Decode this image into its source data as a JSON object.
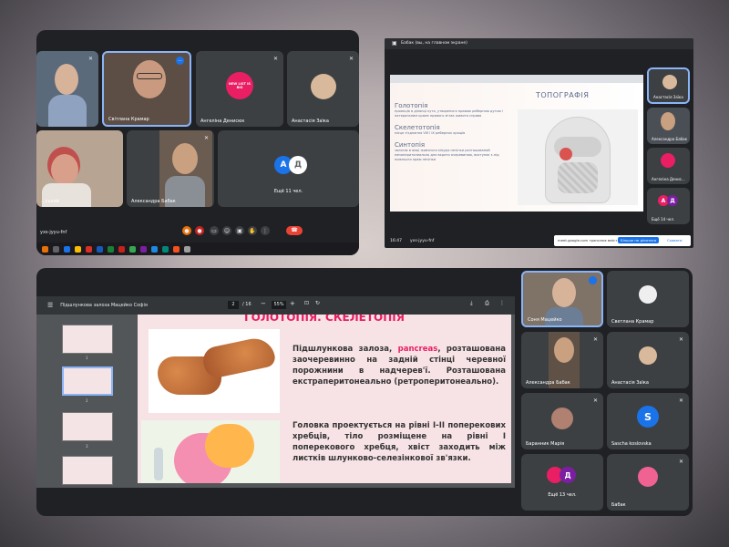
{
  "meet_top_left": {
    "participants": [
      {
        "name": "Світлана Крамар"
      },
      {
        "name": "Ангеліна Денисюк"
      },
      {
        "name": "Анастасія Заїка"
      },
      {
        "name": "Александра Бабак"
      },
      {
        "name": "...ський"
      }
    ],
    "more": "Ещё 11 чел.",
    "avatars": [
      "А",
      "Д"
    ],
    "meeting_code": "yxs-jyyu-fnf",
    "badge_text": "...",
    "logo_text": "NEW LIST IS BIG"
  },
  "meet_top_right": {
    "window_title": "Бабак (вы, на главном экране)",
    "time": "16:47",
    "meeting_code": "yxs-jyyu-fnf",
    "share_notice": "meet.google.com транслює вміст",
    "stop_button": "Більше не ділитися",
    "hide_button": "Сховати",
    "side": [
      {
        "name": "Анастасія Заїка"
      },
      {
        "name": "Александра Бабак"
      },
      {
        "name": "Ангеліна Денис..."
      },
      {
        "name": "Ещё 14 чел."
      }
    ],
    "side_avatars": [
      "А",
      "Д"
    ],
    "slide": {
      "title": "ТОПОГРАФІЯ",
      "sections": [
        {
          "heading": "Голотопія",
          "text": "проекція в ділянці кута, утвореного правою реберною дугою і латеральним краєм прямого м'яза живота справа"
        },
        {
          "heading": "Скелетотопія",
          "text": "місце з'єднання VIII і IX реберних хрящів"
        },
        {
          "heading": "Синтопія",
          "text": "залягає в ямці жовчного міхура печінки розташований мезоперитонеально дно вкрито очеревиною, виступає з-під нижнього краю печінки"
        }
      ]
    }
  },
  "meet_bottom": {
    "pdf_title": "Підшлункова залоза Мацейко Софія",
    "page_current": "2",
    "page_total": "/ 16",
    "zoom": "55%",
    "thumb_numbers": [
      "1",
      "2",
      "3"
    ],
    "slide_title": "ГОЛОТОПІЯ. СКЕЛЕТОПІЯ",
    "para1_before": "Підшлункова залоза,",
    "para1_highlight": "pancreas",
    "para1_after": ", розташована заочеревинно на задній стінці черевної порожнини в надчерев'ї. Розташована екстраперитонеально (ретроперитонеально).",
    "para2": "Головка проектується на рівні І-ІІ поперекових хребців, тіло розміщене на рівні І поперекового хребця, хвіст заходить між листків шлунково-селезінкової зв'язки.",
    "participants": [
      {
        "name": "Соня Мацейко"
      },
      {
        "name": "Светлана Крамар"
      },
      {
        "name": "Александра Бабак"
      },
      {
        "name": "Анастасія Заїка"
      },
      {
        "name": "Баранник Марія"
      },
      {
        "name": "Sascha koslovska"
      },
      {
        "name": "Ещё 13 чел."
      },
      {
        "name": "Бабак"
      }
    ],
    "s_avatar": "S",
    "more_avatars": [
      "Д"
    ]
  },
  "colors": {
    "meet_bg": "#202124",
    "tile": "#3c4043",
    "accent": "#8ab4f8",
    "end_call": "#ea4335",
    "highlight": "#e91e63",
    "blue_avatar": "#1a73e8"
  }
}
